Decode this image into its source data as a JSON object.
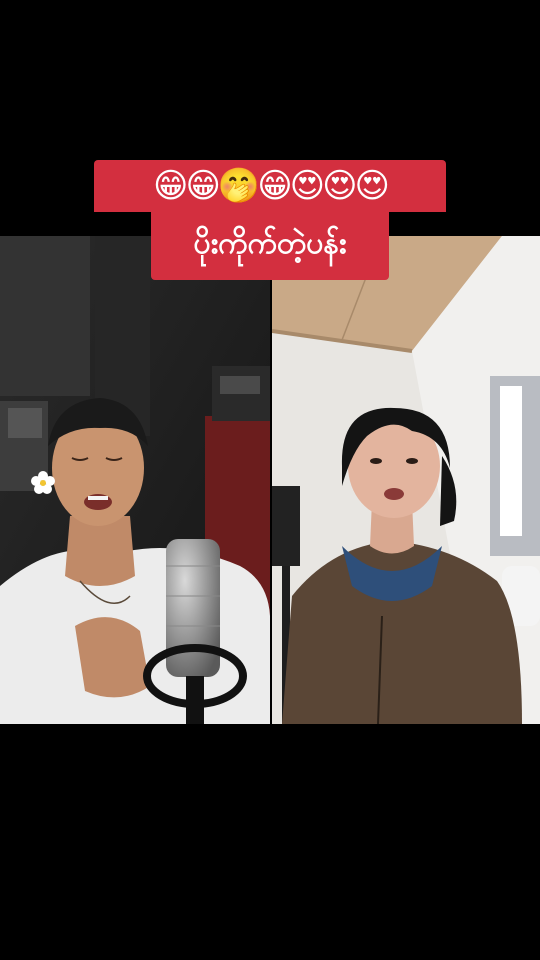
{
  "caption": {
    "emoji_line": "😁😁🤭😁😍😍😍",
    "text_line": "ပိုးကိုက်တဲ့ပန်း"
  },
  "colors": {
    "background": "#000000",
    "caption_background": "#d32f3f",
    "caption_text": "#ffffff"
  },
  "duet": {
    "left_panel": "man singing into a studio microphone, flower behind ear",
    "right_panel": "woman singing in a room wearing a brown zip jacket"
  }
}
